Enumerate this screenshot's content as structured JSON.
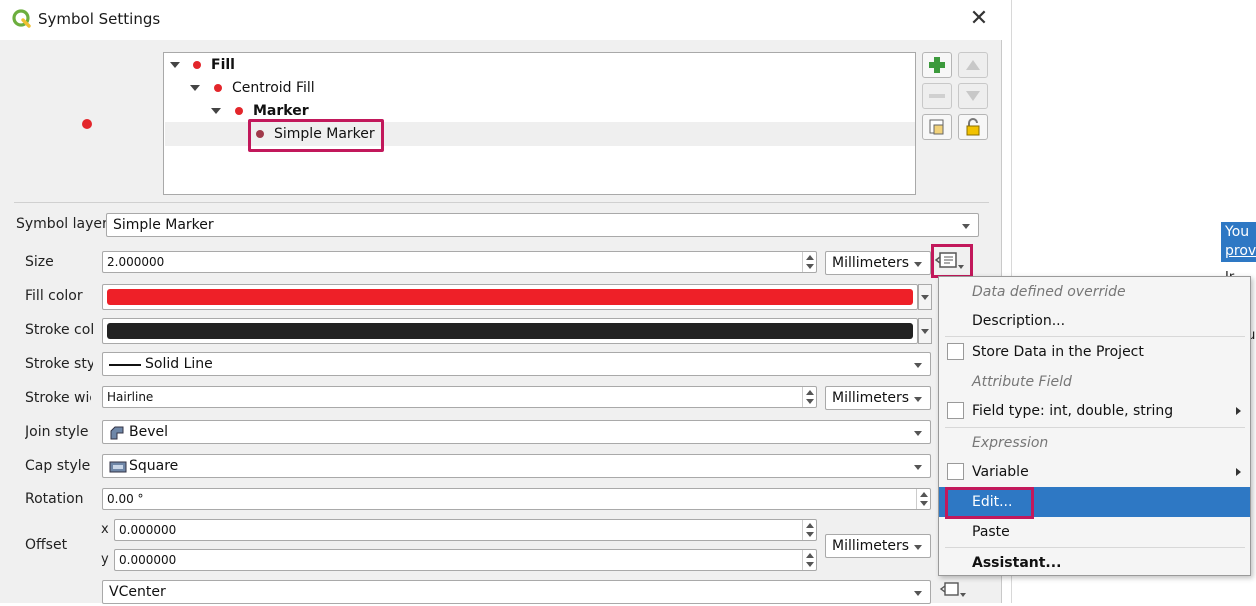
{
  "window": {
    "title": "Symbol Settings",
    "close_glyph": "✕"
  },
  "colors": {
    "fill_color": "#ee2028",
    "stroke_color": "#222222",
    "highlight": "#c2185b",
    "menu_active": "#2e78c4"
  },
  "tree": {
    "items": [
      {
        "label": "Fill"
      },
      {
        "label": "Centroid Fill"
      },
      {
        "label": "Marker"
      },
      {
        "label": "Simple Marker"
      }
    ]
  },
  "tools": {
    "icons": [
      "add-layer-icon",
      "move-up-icon",
      "remove-layer-icon",
      "move-down-icon",
      "duplicate-layer-icon",
      "lock-icon"
    ]
  },
  "form": {
    "symbol_layer_type": {
      "label": "Symbol layer t",
      "value": "Simple Marker"
    },
    "size": {
      "label": "Size",
      "value": "2.000000",
      "unit": "Millimeters"
    },
    "fill_color": {
      "label": "Fill color"
    },
    "stroke_color": {
      "label": "Stroke col"
    },
    "stroke_style": {
      "label": "Stroke sty",
      "value": "Solid Line"
    },
    "stroke_width": {
      "label": "Stroke wic",
      "value": "Hairline",
      "unit": "Millimeters"
    },
    "join_style": {
      "label": "Join style",
      "value": "Bevel"
    },
    "cap_style": {
      "label": "Cap style",
      "value": "Square"
    },
    "rotation": {
      "label": "Rotation",
      "value": "0.00 °"
    },
    "offset": {
      "label": "Offset",
      "x_label": "x",
      "x_value": "0.000000",
      "y_label": "y",
      "y_value": "0.000000",
      "unit": "Millimeters"
    },
    "anchor": {
      "value": "VCenter"
    }
  },
  "menu": {
    "items": [
      {
        "label": "Data defined override",
        "kind": "section"
      },
      {
        "label": "Description...",
        "kind": "action"
      },
      {
        "label": "Store Data in the Project",
        "kind": "check"
      },
      {
        "label": "Attribute Field",
        "kind": "section"
      },
      {
        "label": "Field type: int, double, string",
        "kind": "check-sub"
      },
      {
        "label": "Expression",
        "kind": "section"
      },
      {
        "label": "Variable",
        "kind": "check-sub"
      },
      {
        "label": "Edit...",
        "kind": "active"
      },
      {
        "label": "Paste",
        "kind": "action"
      },
      {
        "label": "Assistant...",
        "kind": "bold"
      }
    ]
  },
  "right_panel": {
    "line1": "You",
    "line2": "prov",
    "line3": "Ir",
    "line4": "tu"
  }
}
